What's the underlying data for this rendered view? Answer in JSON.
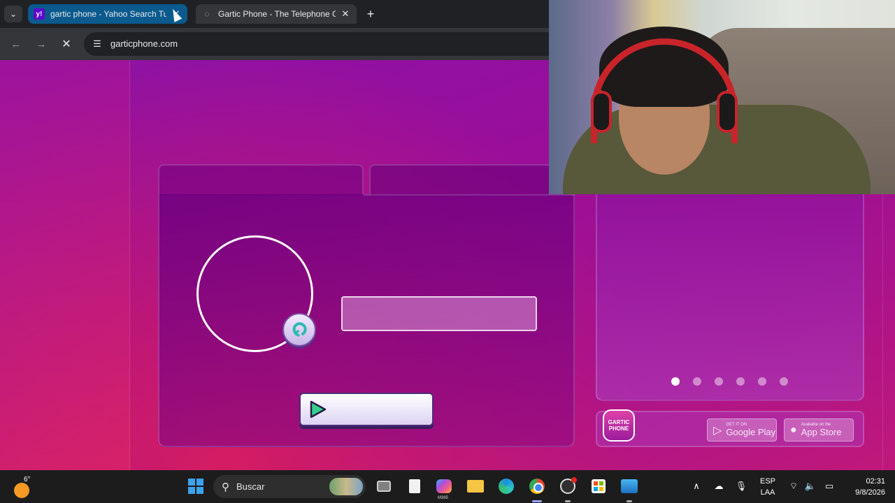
{
  "browser": {
    "tabs": [
      {
        "title": "gartic phone - Yahoo Search Tu",
        "favicon": "yahoo-icon"
      },
      {
        "title": "Gartic Phone - The Telephone G",
        "favicon": "loading-icon"
      }
    ],
    "url": "garticphone.com"
  },
  "page": {
    "carousel_dots": 6,
    "carousel_active": 1,
    "logo_text": "GARTIC PHONE",
    "google_play": {
      "small": "GET IT ON",
      "big": "Google Play"
    },
    "app_store": {
      "small": "Available on the",
      "big": "App Store"
    }
  },
  "taskbar": {
    "weather_temp": "6°",
    "search_placeholder": "Buscar",
    "m365_label": "M365",
    "language": {
      "line1": "ESP",
      "line2": "LAA"
    },
    "clock": {
      "time": "02:31",
      "date": "9/8/2026"
    }
  },
  "colors": {
    "page_accent": "#9a0e9a",
    "taskbar_bg": "#1c1c1c",
    "tabstrip_bg": "#202124",
    "active_tab": "#0a5a8e"
  }
}
